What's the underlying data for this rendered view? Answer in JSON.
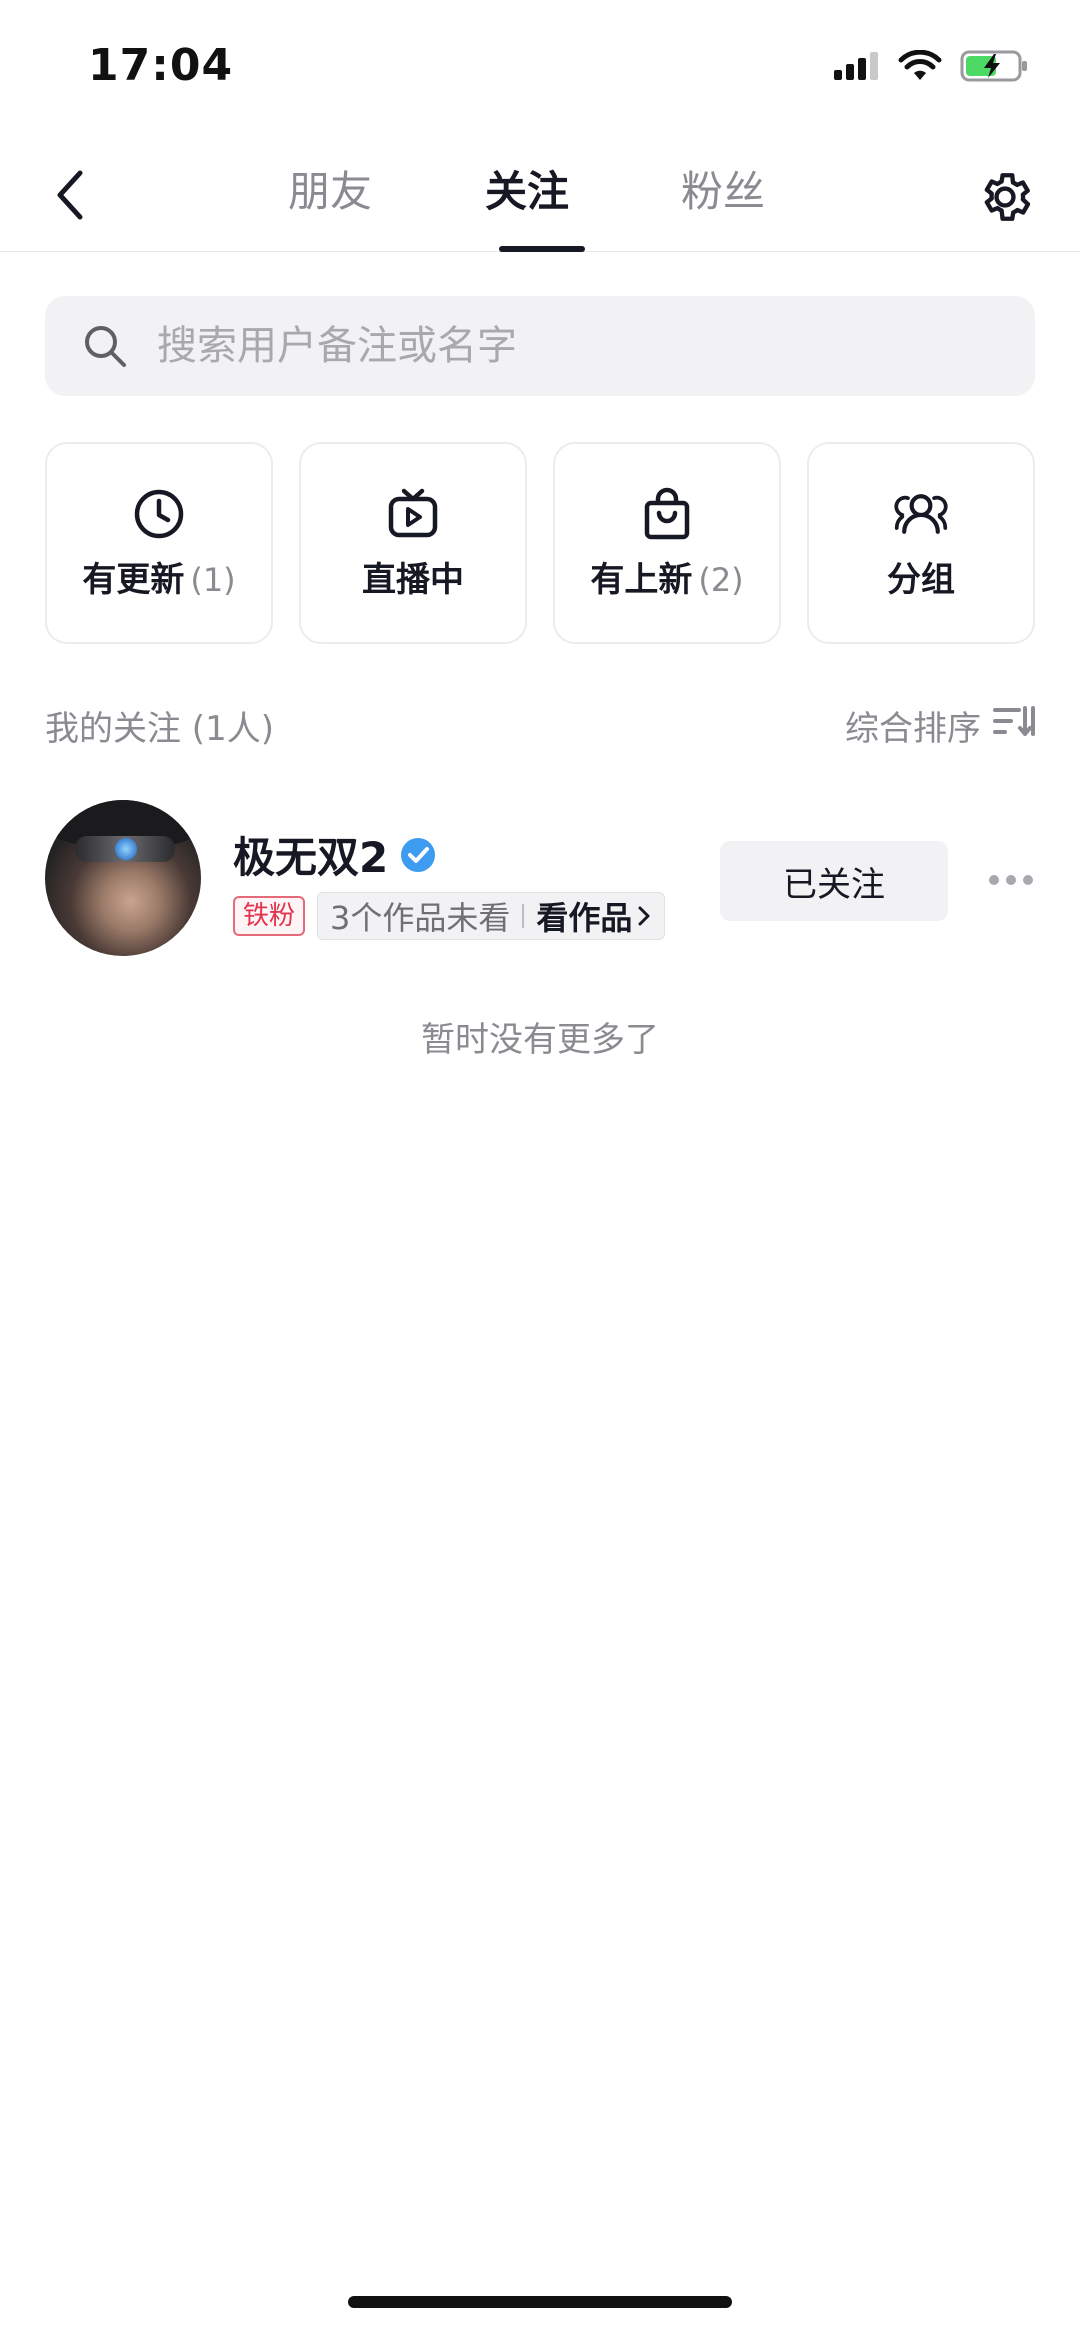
{
  "status": {
    "time": "17:04"
  },
  "nav": {
    "tabs": [
      {
        "label": "朋友"
      },
      {
        "label": "关注"
      },
      {
        "label": "粉丝"
      }
    ],
    "active_tab": "关注"
  },
  "search": {
    "placeholder": "搜索用户备注或名字"
  },
  "filters": [
    {
      "label": "有更新",
      "count": "(1)",
      "icon": "clock-icon"
    },
    {
      "label": "直播中",
      "count": "",
      "icon": "live-tv-icon"
    },
    {
      "label": "有上新",
      "count": "(2)",
      "icon": "shopping-bag-icon"
    },
    {
      "label": "分组",
      "count": "",
      "icon": "group-icon"
    }
  ],
  "section": {
    "title": "我的关注 (1人)",
    "sort_label": "综合排序"
  },
  "following": [
    {
      "name": "极无双2",
      "verified": true,
      "fan_badge": "铁粉",
      "unseen_works": "3个作品未看",
      "works_link": "看作品",
      "follow_status": "已关注"
    }
  ],
  "footer": {
    "no_more": "暂时没有更多了"
  },
  "colors": {
    "accent_text": "#161823",
    "muted_text": "#8a8b91",
    "fan_badge": "#e3344e",
    "verified": "#3d9bf0"
  }
}
